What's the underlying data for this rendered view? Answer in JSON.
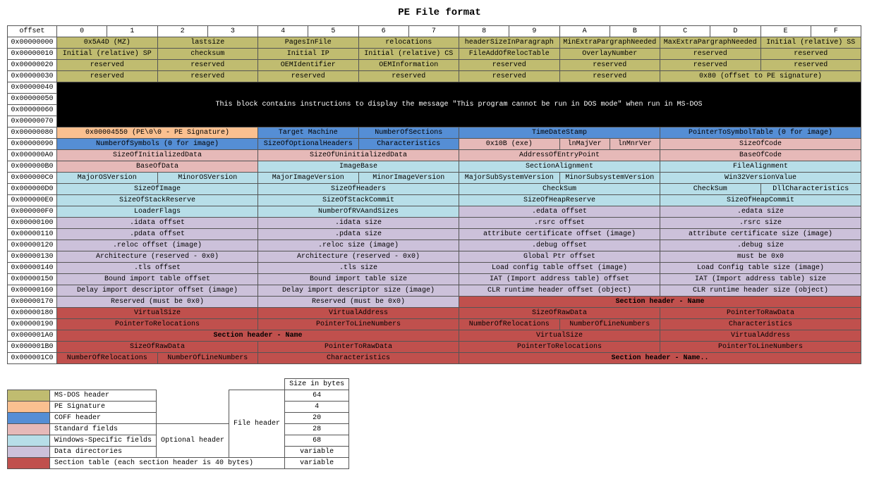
{
  "title": "PE File format",
  "header": {
    "offset": "offset",
    "cols": [
      "0",
      "1",
      "2",
      "3",
      "4",
      "5",
      "6",
      "7",
      "8",
      "9",
      "A",
      "B",
      "C",
      "D",
      "E",
      "F"
    ]
  },
  "dos_message": "This block contains instructions to display the message \"This program cannot be run in DOS mode\" when run in MS-DOS",
  "rows": [
    {
      "offset": "0x00000000",
      "cells": [
        {
          "c": "ms",
          "s": 2,
          "t": "0x5A4D (MZ)"
        },
        {
          "c": "ms",
          "s": 2,
          "t": "lastsize"
        },
        {
          "c": "ms",
          "s": 2,
          "t": "PagesInFile"
        },
        {
          "c": "ms",
          "s": 2,
          "t": "relocations"
        },
        {
          "c": "ms",
          "s": 2,
          "t": "headerSizeInParagraph"
        },
        {
          "c": "ms",
          "s": 2,
          "t": "MinExtraPargraphNeeded"
        },
        {
          "c": "ms",
          "s": 2,
          "t": "MaxExtraPargraphNeeded"
        },
        {
          "c": "ms",
          "s": 2,
          "t": "Initial (relative) SS"
        }
      ]
    },
    {
      "offset": "0x00000010",
      "cells": [
        {
          "c": "ms",
          "s": 2,
          "t": "Initial (relative) SP"
        },
        {
          "c": "ms",
          "s": 2,
          "t": "checksum"
        },
        {
          "c": "ms",
          "s": 2,
          "t": "Initial IP"
        },
        {
          "c": "ms",
          "s": 2,
          "t": "Initial (relative) CS"
        },
        {
          "c": "ms",
          "s": 2,
          "t": "FileAddOfRelocTable"
        },
        {
          "c": "ms",
          "s": 2,
          "t": "OverlayNumber"
        },
        {
          "c": "ms",
          "s": 2,
          "t": "reserved"
        },
        {
          "c": "ms",
          "s": 2,
          "t": "reserved"
        }
      ]
    },
    {
      "offset": "0x00000020",
      "cells": [
        {
          "c": "ms",
          "s": 2,
          "t": "reserved"
        },
        {
          "c": "ms",
          "s": 2,
          "t": "reserved"
        },
        {
          "c": "ms",
          "s": 2,
          "t": "OEMIdentifier"
        },
        {
          "c": "ms",
          "s": 2,
          "t": "OEMInformation"
        },
        {
          "c": "ms",
          "s": 2,
          "t": "reserved"
        },
        {
          "c": "ms",
          "s": 2,
          "t": "reserved"
        },
        {
          "c": "ms",
          "s": 2,
          "t": "reserved"
        },
        {
          "c": "ms",
          "s": 2,
          "t": "reserved"
        }
      ]
    },
    {
      "offset": "0x00000030",
      "cells": [
        {
          "c": "ms",
          "s": 2,
          "t": "reserved"
        },
        {
          "c": "ms",
          "s": 2,
          "t": "reserved"
        },
        {
          "c": "ms",
          "s": 2,
          "t": "reserved"
        },
        {
          "c": "ms",
          "s": 2,
          "t": "reserved"
        },
        {
          "c": "ms",
          "s": 2,
          "t": "reserved"
        },
        {
          "c": "ms",
          "s": 2,
          "t": "reserved"
        },
        {
          "c": "ms",
          "s": 4,
          "t": "0x80 (offset to PE signature)"
        }
      ]
    },
    {
      "offset": "0x00000040",
      "dosrow": true
    },
    {
      "offset": "0x00000050",
      "skip": true
    },
    {
      "offset": "0x00000060",
      "skip": true
    },
    {
      "offset": "0x00000070",
      "skip": true
    },
    {
      "offset": "0x00000080",
      "cells": [
        {
          "c": "sig",
          "s": 4,
          "t": "0x00004550 (PE\\0\\0 - PE Signature)"
        },
        {
          "c": "coff",
          "s": 2,
          "t": "Target Machine"
        },
        {
          "c": "coff",
          "s": 2,
          "t": "NumberOfSections"
        },
        {
          "c": "coff",
          "s": 4,
          "t": "TimeDateStamp"
        },
        {
          "c": "coff",
          "s": 4,
          "t": "PointerToSymbolTable (0 for image)"
        }
      ]
    },
    {
      "offset": "0x00000090",
      "cells": [
        {
          "c": "coff",
          "s": 4,
          "t": "NumberOfSymbols (0 for image)"
        },
        {
          "c": "coff",
          "s": 2,
          "t": "SizeOfOptionalHeaders"
        },
        {
          "c": "coff",
          "s": 2,
          "t": "Characteristics"
        },
        {
          "c": "std",
          "s": 2,
          "t": "0x10B (exe)"
        },
        {
          "c": "std",
          "s": 1,
          "t": "lnMajVer"
        },
        {
          "c": "std",
          "s": 1,
          "t": "lnMnrVer"
        },
        {
          "c": "std",
          "s": 4,
          "t": "SizeOfCode"
        }
      ]
    },
    {
      "offset": "0x000000A0",
      "cells": [
        {
          "c": "std",
          "s": 4,
          "t": "SizeOfInitializedData"
        },
        {
          "c": "std",
          "s": 4,
          "t": "SizeOfUninitializedData"
        },
        {
          "c": "std",
          "s": 4,
          "t": "AddressOfEntryPoint"
        },
        {
          "c": "std",
          "s": 4,
          "t": "BaseOfCode"
        }
      ]
    },
    {
      "offset": "0x000000B0",
      "cells": [
        {
          "c": "std",
          "s": 4,
          "t": "BaseOfData"
        },
        {
          "c": "win",
          "s": 4,
          "t": "ImageBase"
        },
        {
          "c": "win",
          "s": 4,
          "t": "SectionAlignment"
        },
        {
          "c": "win",
          "s": 4,
          "t": "FileAlignment"
        }
      ]
    },
    {
      "offset": "0x000000C0",
      "cells": [
        {
          "c": "win",
          "s": 2,
          "t": "MajorOSVersion"
        },
        {
          "c": "win",
          "s": 2,
          "t": "MinorOSVersion"
        },
        {
          "c": "win",
          "s": 2,
          "t": "MajorImageVersion"
        },
        {
          "c": "win",
          "s": 2,
          "t": "MinorImageVersion"
        },
        {
          "c": "win",
          "s": 2,
          "t": "MajorSubSystemVersion"
        },
        {
          "c": "win",
          "s": 2,
          "t": "MinorSubsystemVersion"
        },
        {
          "c": "win",
          "s": 4,
          "t": "Win32VersionValue"
        }
      ]
    },
    {
      "offset": "0x000000D0",
      "cells": [
        {
          "c": "win",
          "s": 4,
          "t": "SizeOfImage"
        },
        {
          "c": "win",
          "s": 4,
          "t": "SizeOfHeaders"
        },
        {
          "c": "win",
          "s": 4,
          "t": "CheckSum"
        },
        {
          "c": "win",
          "s": 2,
          "t": "CheckSum"
        },
        {
          "c": "win",
          "s": 2,
          "t": "DllCharacteristics"
        }
      ]
    },
    {
      "offset": "0x000000E0",
      "cells": [
        {
          "c": "win",
          "s": 4,
          "t": "SizeOfStackReserve"
        },
        {
          "c": "win",
          "s": 4,
          "t": "SizeOfStackCommit"
        },
        {
          "c": "win",
          "s": 4,
          "t": "SizeOfHeapReserve"
        },
        {
          "c": "win",
          "s": 4,
          "t": "SizeOfHeapCommit"
        }
      ]
    },
    {
      "offset": "0x000000F0",
      "cells": [
        {
          "c": "win",
          "s": 4,
          "t": "LoaderFlags"
        },
        {
          "c": "win",
          "s": 4,
          "t": "NumberOfRVAandSizes"
        },
        {
          "c": "dd",
          "s": 4,
          "t": ".edata offset"
        },
        {
          "c": "dd",
          "s": 4,
          "t": ".edata size"
        }
      ]
    },
    {
      "offset": "0x00000100",
      "cells": [
        {
          "c": "dd",
          "s": 4,
          "t": ".idata offset"
        },
        {
          "c": "dd",
          "s": 4,
          "t": ".idata size"
        },
        {
          "c": "dd",
          "s": 4,
          "t": ".rsrc offset"
        },
        {
          "c": "dd",
          "s": 4,
          "t": ".rsrc size"
        }
      ]
    },
    {
      "offset": "0x00000110",
      "cells": [
        {
          "c": "dd",
          "s": 4,
          "t": ".pdata offset"
        },
        {
          "c": "dd",
          "s": 4,
          "t": ".pdata size"
        },
        {
          "c": "dd",
          "s": 4,
          "t": "attribute certificate offset (image)"
        },
        {
          "c": "dd",
          "s": 4,
          "t": "attribute certificate size (image)"
        }
      ]
    },
    {
      "offset": "0x00000120",
      "cells": [
        {
          "c": "dd",
          "s": 4,
          "t": ".reloc offset (image)"
        },
        {
          "c": "dd",
          "s": 4,
          "t": ".reloc size (image)"
        },
        {
          "c": "dd",
          "s": 4,
          "t": ".debug offset"
        },
        {
          "c": "dd",
          "s": 4,
          "t": ".debug size"
        }
      ]
    },
    {
      "offset": "0x00000130",
      "cells": [
        {
          "c": "dd",
          "s": 4,
          "t": "Architecture (reserved - 0x0)"
        },
        {
          "c": "dd",
          "s": 4,
          "t": "Architecture (reserved - 0x0)"
        },
        {
          "c": "dd",
          "s": 4,
          "t": "Global Ptr offset"
        },
        {
          "c": "dd",
          "s": 4,
          "t": "must be 0x0"
        }
      ]
    },
    {
      "offset": "0x00000140",
      "cells": [
        {
          "c": "dd",
          "s": 4,
          "t": ".tls offset"
        },
        {
          "c": "dd",
          "s": 4,
          "t": ".tls size"
        },
        {
          "c": "dd",
          "s": 4,
          "t": "Load config table offset (image)"
        },
        {
          "c": "dd",
          "s": 4,
          "t": "Load Config table size (image)"
        }
      ]
    },
    {
      "offset": "0x00000150",
      "cells": [
        {
          "c": "dd",
          "s": 4,
          "t": "Bound import table offset"
        },
        {
          "c": "dd",
          "s": 4,
          "t": "Bound import table size"
        },
        {
          "c": "dd",
          "s": 4,
          "t": "IAT (Import address table) offset"
        },
        {
          "c": "dd",
          "s": 4,
          "t": "IAT (Import address table) size"
        }
      ]
    },
    {
      "offset": "0x00000160",
      "cells": [
        {
          "c": "dd",
          "s": 4,
          "t": "Delay import descriptor offset (image)"
        },
        {
          "c": "dd",
          "s": 4,
          "t": "Delay import descriptor size (image)"
        },
        {
          "c": "dd",
          "s": 4,
          "t": "CLR runtime header offset (object)"
        },
        {
          "c": "dd",
          "s": 4,
          "t": "CLR runtime header size (object)"
        }
      ]
    },
    {
      "offset": "0x00000170",
      "cells": [
        {
          "c": "dd",
          "s": 4,
          "t": "Reserved (must be 0x0)"
        },
        {
          "c": "dd",
          "s": 4,
          "t": "Reserved (must be 0x0)"
        },
        {
          "c": "secname",
          "s": 8,
          "t": "Section header - Name"
        }
      ]
    },
    {
      "offset": "0x00000180",
      "cells": [
        {
          "c": "sec",
          "s": 4,
          "t": "VirtualSize"
        },
        {
          "c": "sec",
          "s": 4,
          "t": "VirtualAddress"
        },
        {
          "c": "sec",
          "s": 4,
          "t": "SizeOfRawData"
        },
        {
          "c": "sec",
          "s": 4,
          "t": "PointerToRawData"
        }
      ]
    },
    {
      "offset": "0x00000190",
      "cells": [
        {
          "c": "sec",
          "s": 4,
          "t": "PointerToRelocations"
        },
        {
          "c": "sec",
          "s": 4,
          "t": "PointerToLineNumbers"
        },
        {
          "c": "sec",
          "s": 2,
          "t": "NumberOfRelocations"
        },
        {
          "c": "sec",
          "s": 2,
          "t": "NumberOfLineNumbers"
        },
        {
          "c": "sec",
          "s": 4,
          "t": "Characteristics"
        }
      ]
    },
    {
      "offset": "0x000001A0",
      "cells": [
        {
          "c": "secname",
          "s": 8,
          "t": "Section header - Name"
        },
        {
          "c": "sec",
          "s": 4,
          "t": "VirtualSize"
        },
        {
          "c": "sec",
          "s": 4,
          "t": "VirtualAddress"
        }
      ]
    },
    {
      "offset": "0x000001B0",
      "cells": [
        {
          "c": "sec",
          "s": 4,
          "t": "SizeOfRawData"
        },
        {
          "c": "sec",
          "s": 4,
          "t": "PointerToRawData"
        },
        {
          "c": "sec",
          "s": 4,
          "t": "PointerToRelocations"
        },
        {
          "c": "sec",
          "s": 4,
          "t": "PointerToLineNumbers"
        }
      ]
    },
    {
      "offset": "0x000001C0",
      "cells": [
        {
          "c": "sec",
          "s": 2,
          "t": "NumberOfRelocations"
        },
        {
          "c": "sec",
          "s": 2,
          "t": "NumberOfLineNumbers"
        },
        {
          "c": "sec",
          "s": 4,
          "t": "Characteristics"
        },
        {
          "c": "secname",
          "s": 8,
          "t": "Section header - Name.."
        }
      ]
    }
  ],
  "legend": {
    "size_header": "Size in bytes",
    "file_header_label": "File header",
    "optional_header_label": "Optional header",
    "rows": [
      {
        "c": "ms",
        "label": "MS-DOS header",
        "size": "64",
        "opt": false
      },
      {
        "c": "sig",
        "label": "PE Signature",
        "size": "4",
        "opt": false
      },
      {
        "c": "coff",
        "label": "COFF header",
        "size": "20",
        "opt": false
      },
      {
        "c": "std",
        "label": "Standard fields",
        "size": "28",
        "opt": true
      },
      {
        "c": "win",
        "label": "Windows-Specific fields",
        "size": "68",
        "opt": true
      },
      {
        "c": "dd",
        "label": "Data directories",
        "size": "variable",
        "opt": true
      },
      {
        "c": "sec",
        "label": "Section table (each section header is 40 bytes)",
        "size": "variable",
        "opt": false,
        "wide": true
      }
    ]
  }
}
